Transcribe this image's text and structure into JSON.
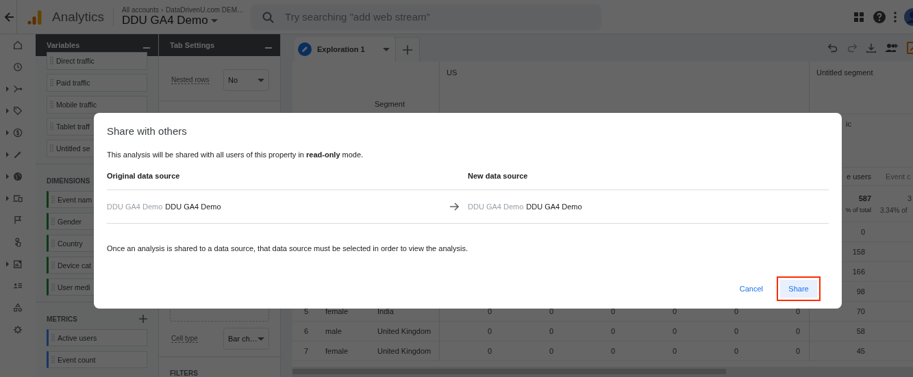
{
  "top_bar": {
    "product": "Analytics",
    "breadcrumb": [
      "All accounts",
      "DataDrivenU.com DEM…"
    ],
    "property": "DDU GA4 Demo",
    "search": {
      "placeholder": "Try searching \"add web stream\""
    }
  },
  "nav_rail": [
    {
      "expandable": false
    },
    {
      "expandable": false
    },
    {
      "expandable": true
    },
    {
      "expandable": true
    },
    {
      "expandable": true
    },
    {
      "expandable": true
    },
    {
      "expandable": true
    },
    {
      "expandable": true
    },
    {
      "expandable": false
    },
    {
      "expandable": false
    },
    {
      "expandable": true
    },
    {
      "expandable": false
    },
    {
      "expandable": false
    },
    {
      "expandable": false
    }
  ],
  "variables_panel": {
    "title": "Variables",
    "segments": [
      "Direct traffic",
      "Paid traffic",
      "Mobile traffic",
      "Tablet traff",
      "Untitled se"
    ],
    "dimensions": {
      "title": "DIMENSIONS",
      "items": [
        "Event nam",
        "Gender",
        "Country",
        "Device cat",
        "User medi"
      ]
    },
    "metrics": {
      "title": "METRICS",
      "items": [
        "Active users",
        "Event count"
      ]
    }
  },
  "tab_settings": {
    "title": "Tab Settings",
    "fields": [
      {
        "label": "Nested rows",
        "value": "No"
      },
      {
        "label": "Cell type",
        "value": "Bar ch…"
      }
    ],
    "filters_title": "FILTERS"
  },
  "exploration": {
    "tabs": [
      {
        "label": "Exploration 1",
        "selected": true
      }
    ],
    "table": {
      "segment_label": "Segment",
      "segments": [
        "US",
        "Untitled segment"
      ],
      "dimension_header": "ic",
      "metric_headers": [
        "e users",
        "Event c"
      ],
      "totals": {
        "value": "587",
        "share": "% of total",
        "next_value": "3",
        "next_share": "3.34% of"
      },
      "rows": [
        {
          "users": "0"
        },
        {
          "users": "158"
        },
        {
          "users": "166"
        },
        {
          "users": "98"
        },
        {
          "index": "5",
          "gender": "female",
          "country": "India",
          "values": [
            "0",
            "0",
            "0",
            "0",
            "0",
            "0"
          ],
          "users": "70"
        },
        {
          "index": "6",
          "gender": "male",
          "country": "United Kingdom",
          "values": [
            "0",
            "0",
            "0",
            "0",
            "0",
            "0"
          ],
          "users": "58"
        },
        {
          "index": "7",
          "gender": "female",
          "country": "United Kingdom",
          "values": [
            "0",
            "0",
            "0",
            "0",
            "0",
            "0"
          ],
          "users": "45"
        }
      ]
    }
  },
  "dialog": {
    "title": "Share with others",
    "message": "This analysis will be shared with all users of this property in **read-only** mode.",
    "columns": [
      "Original data source",
      "New data source"
    ],
    "sources": [
      {
        "account": "DDU GA4 Demo",
        "property": "DDU GA4 Demo"
      },
      {
        "account": "DDU GA4 Demo",
        "property": "DDU GA4 Demo"
      }
    ],
    "note": "Once an analysis is shared to a data source, that data source must be selected in order to view the analysis.",
    "buttons": [
      {
        "label": "Cancel",
        "kind": "text",
        "highlighted": false
      },
      {
        "label": "Share",
        "kind": "tonal",
        "highlighted": true
      }
    ]
  }
}
